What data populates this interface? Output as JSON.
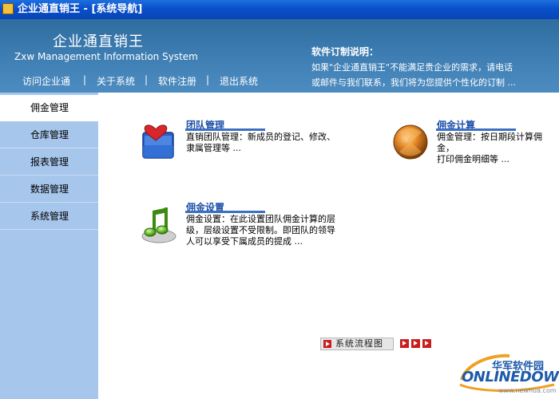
{
  "window": {
    "title": "企业通直销王 - [系统导航]"
  },
  "header": {
    "brand_cn": "企业通直销王",
    "brand_en": "Zxw Management Information System",
    "nav": [
      "访问企业通",
      "|",
      "关于系统",
      "|",
      "软件注册",
      "|",
      "退出系统"
    ],
    "notice_title": "软件订制说明：",
    "notice_line1": "如果\"企业通直销王\"不能满足贵企业的需求，请电话",
    "notice_line2": "或邮件与我们联系，我们将为您提供个性化的订制 ..."
  },
  "sidebar": {
    "items": [
      {
        "label": "佣金管理",
        "active": true
      },
      {
        "label": "仓库管理",
        "active": false
      },
      {
        "label": "报表管理",
        "active": false
      },
      {
        "label": "数据管理",
        "active": false
      },
      {
        "label": "系统管理",
        "active": false
      }
    ]
  },
  "cards": [
    {
      "title": "团队管理",
      "desc_lines": [
        "直销团队管理：新成员的登记、修改、",
        "隶属管理等 ..."
      ],
      "icon": "folder-heart-icon"
    },
    {
      "title": "佣金计算",
      "desc_lines": [
        "佣金管理：按日期段计算佣金，",
        "打印佣金明细等 ..."
      ],
      "icon": "orange-orb-icon"
    },
    {
      "title": "佣金设置",
      "desc_lines": [
        "佣金设置：在此设置团队佣金计算的层",
        "级，层级设置不受限制。即团队的领导",
        "人可以享受下属成员的提成 ..."
      ],
      "icon": "music-note-icon"
    }
  ],
  "flow": {
    "label": "系统流程图"
  },
  "watermark": {
    "cn": "华军软件园",
    "en": "ONLINEDOWN",
    "url": "www.newhua.com"
  },
  "colors": {
    "header": "#3f7fb4",
    "sidebar": "#a7c6ec",
    "titlebar": "#0a4fc8",
    "link": "#1b4fa8"
  }
}
